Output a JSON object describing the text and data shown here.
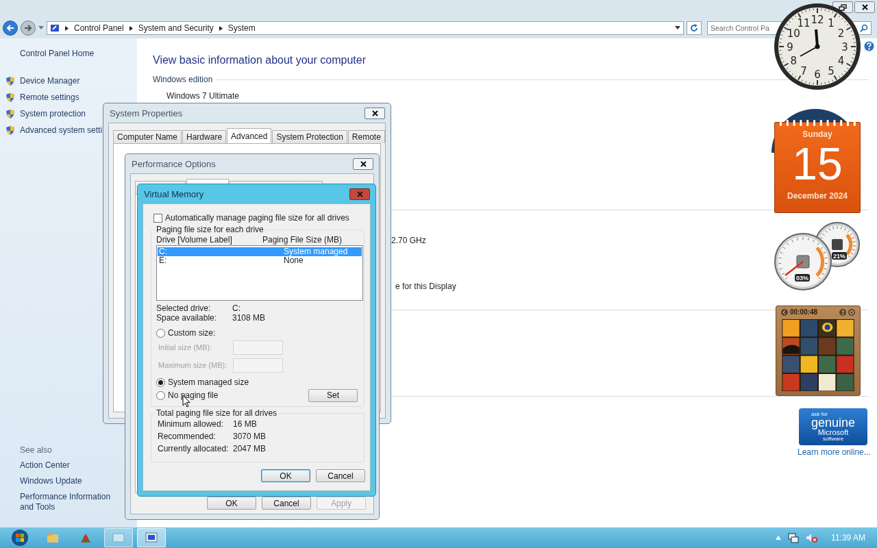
{
  "explorer": {
    "breadcrumb": [
      "Control Panel",
      "System and Security",
      "System"
    ],
    "search": {
      "placeholder": "Search Control Pa"
    },
    "sidebar": {
      "home": "Control Panel Home",
      "tasks": [
        "Device Manager",
        "Remote settings",
        "System protection",
        "Advanced system setti"
      ],
      "see_also": {
        "title": "See also",
        "links": [
          "Action Center",
          "Windows Update",
          "Performance Information and Tools"
        ]
      }
    },
    "main": {
      "heading": "View basic information about your computer",
      "section_title": "Windows edition",
      "edition": "Windows 7 Ultimate",
      "fragments": [
        "2.70 GHz",
        "e for this Display"
      ]
    }
  },
  "system_properties": {
    "title": "System Properties",
    "tabs": [
      {
        "label": "Computer Name",
        "selected": false
      },
      {
        "label": "Hardware",
        "selected": false
      },
      {
        "label": "Advanced",
        "selected": true
      },
      {
        "label": "System Protection",
        "selected": false
      },
      {
        "label": "Remote",
        "selected": false
      }
    ]
  },
  "performance_options": {
    "title": "Performance Options",
    "tabs": [
      {
        "selected": false
      },
      {
        "selected": true
      },
      {
        "selected": false
      }
    ],
    "buttons": [
      {
        "label": "OK",
        "disabled": false
      },
      {
        "label": "Cancel",
        "disabled": false
      },
      {
        "label": "Apply",
        "disabled": true
      }
    ]
  },
  "virtual_memory": {
    "title": "Virtual Memory",
    "auto_manage": {
      "label": "Automatically manage paging file size for all drives",
      "checked": false
    },
    "drives_group": {
      "title": "Paging file size for each drive",
      "columns": [
        "Drive  [Volume Label]",
        "Paging File Size (MB)"
      ],
      "drives": [
        {
          "drive": "C:",
          "size": "System managed",
          "selected": true
        },
        {
          "drive": "E:",
          "size": "None",
          "selected": false
        }
      ],
      "info": [
        {
          "label": "Selected drive:",
          "value": "C:"
        },
        {
          "label": "Space available:",
          "value": "3108 MB"
        }
      ],
      "custom": {
        "label": "Custom size:",
        "selected": false
      },
      "size_fields": [
        {
          "label": "Initial size (MB):",
          "disabled": true
        },
        {
          "label": "Maximum size (MB):",
          "disabled": true
        }
      ],
      "system_managed": {
        "label": "System managed size",
        "selected": true
      },
      "no_paging": {
        "label": "No paging file",
        "selected": false
      },
      "set_button": "Set"
    },
    "totals": {
      "title": "Total paging file size for all drives",
      "rows": [
        {
          "label": "Minimum allowed:",
          "value": "16 MB"
        },
        {
          "label": "Recommended:",
          "value": "3070 MB"
        },
        {
          "label": "Currently allocated:",
          "value": "2047 MB"
        }
      ]
    },
    "buttons": [
      {
        "label": "OK",
        "default": true
      },
      {
        "label": "Cancel",
        "default": false
      }
    ]
  },
  "gadgets": {
    "clock": {
      "numerals": [
        "12",
        "11",
        "1",
        "10",
        "2",
        "9",
        "3",
        "8",
        "4",
        "7",
        "5",
        "6"
      ]
    },
    "calendar": {
      "weekday": "Sunday",
      "day": "15",
      "month": "December 2024"
    },
    "cpu_meter": {
      "cpu": "03%",
      "memory": "21%"
    },
    "puzzle": {
      "timer": "00:00:48"
    },
    "genuine": {
      "lines": [
        "ask for",
        "genuine",
        "Microsoft",
        "software"
      ],
      "link": "Learn more online..."
    }
  },
  "taskbar": {
    "time": "11:39 AM"
  }
}
